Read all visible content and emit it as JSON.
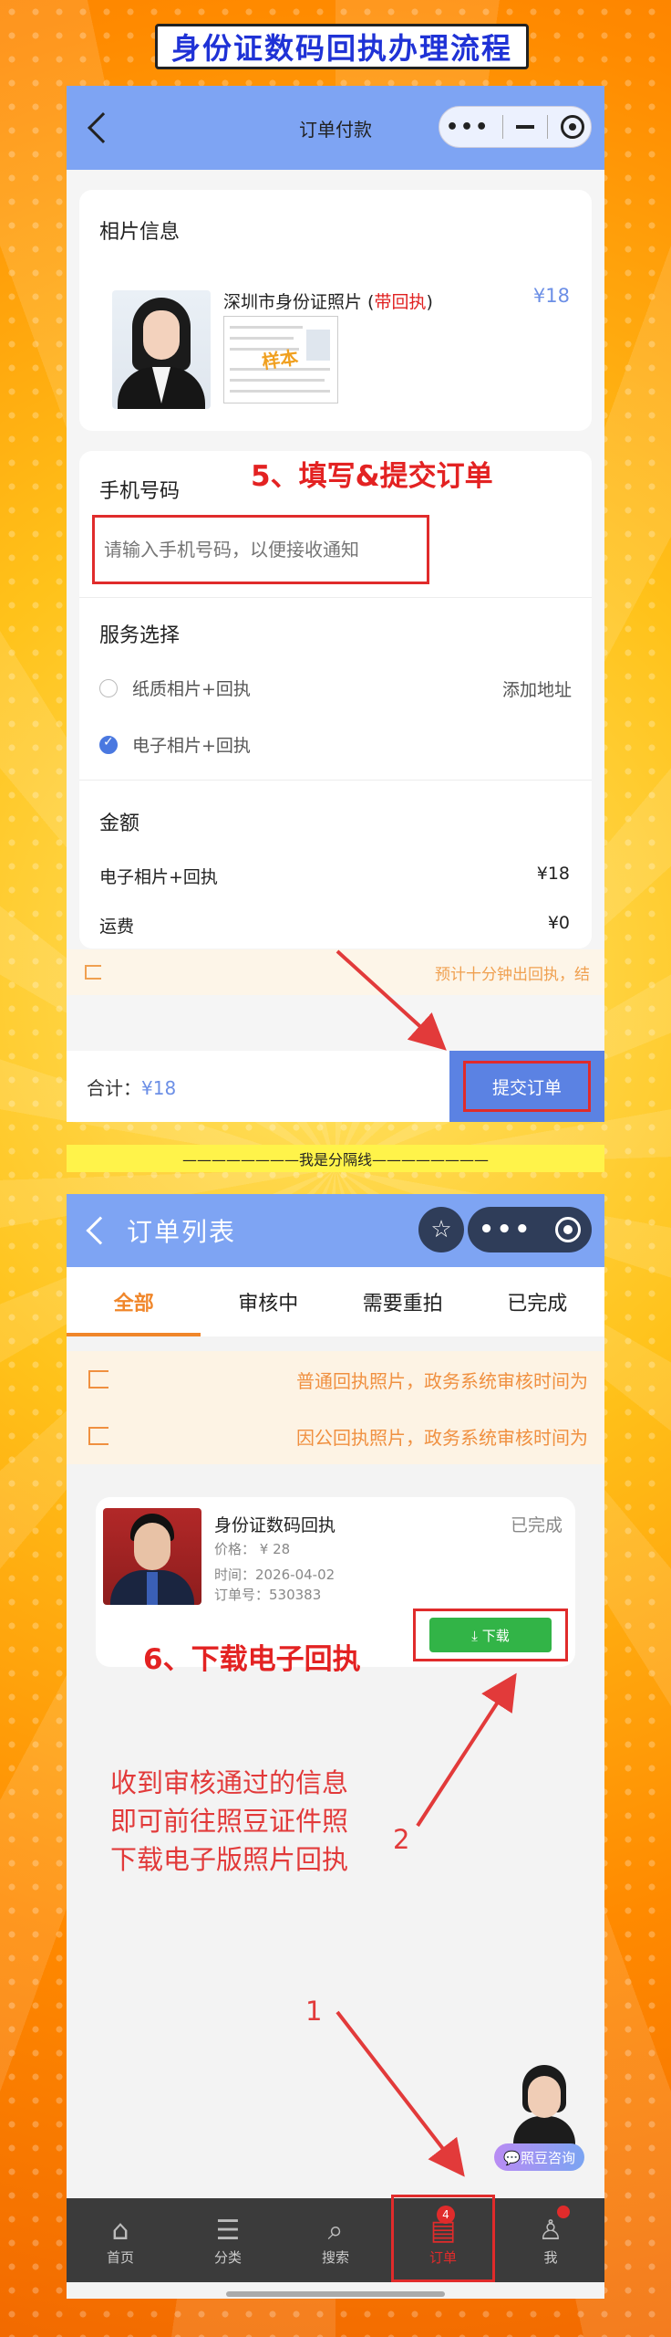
{
  "banner": {
    "title": "身份证数码回执办理流程"
  },
  "order_pay": {
    "header_title": "订单付款",
    "photo_section_label": "相片信息",
    "photo_title": "深圳市身份证照片",
    "photo_title_paren_open": " (",
    "photo_title_red": "带回执",
    "photo_title_paren_close": ")",
    "photo_price": "¥18",
    "sample_stamp": "样本",
    "phone_label": "手机号码",
    "step_title": "5、填写&提交订单",
    "phone_placeholder": "请输入手机号码，以便接收通知",
    "service_label": "服务选择",
    "options": [
      {
        "label": "纸质相片+回执",
        "selected": false
      },
      {
        "label": "电子相片+回执",
        "selected": true
      }
    ],
    "add_address": "添加地址",
    "amount_label": "金额",
    "amount_rows": [
      {
        "label": "电子相片+回执",
        "value": "¥18"
      },
      {
        "label": "运费",
        "value": "¥0"
      }
    ],
    "notice": "预计十分钟出回执，结",
    "total_label": "合计：",
    "total_value": "¥18",
    "submit_label": "提交订单"
  },
  "separator": "————————我是分隔线————————",
  "order_list": {
    "header_title": "订单列表",
    "tabs": [
      "全部",
      "审核中",
      "需要重拍",
      "已完成"
    ],
    "notices": [
      "普通回执照片，政务系统审核时间为",
      "因公回执照片，政务系统审核时间为"
    ],
    "order": {
      "title": "身份证数码回执",
      "status": "已完成",
      "price": "价格： ¥ 28",
      "time": "时间：2026-04-02",
      "order_no": "订单号：530383",
      "download": "⤓ 下载"
    },
    "step_title": "6、下载电子回执",
    "annotation_lines": [
      "收到审核通过的信息",
      "即可前往照豆证件照",
      "下载电子版照片回执"
    ],
    "num_2": "2",
    "num_1": "1",
    "consult": "💬照豆咨询",
    "tabbar": [
      {
        "label": "首页",
        "icon": "home-icon"
      },
      {
        "label": "分类",
        "icon": "category-icon"
      },
      {
        "label": "搜索",
        "icon": "search-icon"
      },
      {
        "label": "订单",
        "icon": "order-icon",
        "badge": "4",
        "active": true
      },
      {
        "label": "我",
        "icon": "user-icon"
      }
    ]
  },
  "colors": {
    "accent_blue": "#7ea4f3",
    "highlight_red": "#e02b2b",
    "tab_orange": "#f0862a",
    "download_green": "#32b447"
  }
}
